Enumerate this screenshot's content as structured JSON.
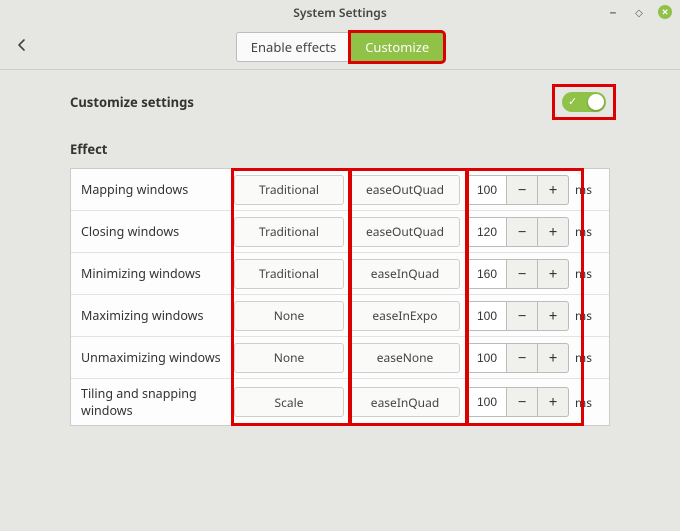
{
  "window": {
    "title": "System Settings"
  },
  "toolbar": {
    "tabs": {
      "enable": "Enable effects",
      "customize": "Customize"
    }
  },
  "section": {
    "title": "Customize settings",
    "toggle_on": true
  },
  "effects": {
    "heading": "Effect",
    "unit": "ms",
    "rows": [
      {
        "label": "Mapping windows",
        "style": "Traditional",
        "easing": "easeOutQuad",
        "duration": "100"
      },
      {
        "label": "Closing windows",
        "style": "Traditional",
        "easing": "easeOutQuad",
        "duration": "120"
      },
      {
        "label": "Minimizing windows",
        "style": "Traditional",
        "easing": "easeInQuad",
        "duration": "160"
      },
      {
        "label": "Maximizing windows",
        "style": "None",
        "easing": "easeInExpo",
        "duration": "100"
      },
      {
        "label": "Unmaximizing windows",
        "style": "None",
        "easing": "easeNone",
        "duration": "100"
      },
      {
        "label": "Tiling and snapping windows",
        "style": "Scale",
        "easing": "easeInQuad",
        "duration": "100"
      }
    ]
  },
  "colors": {
    "accent": "#8fc247",
    "highlight": "#dc0000"
  }
}
